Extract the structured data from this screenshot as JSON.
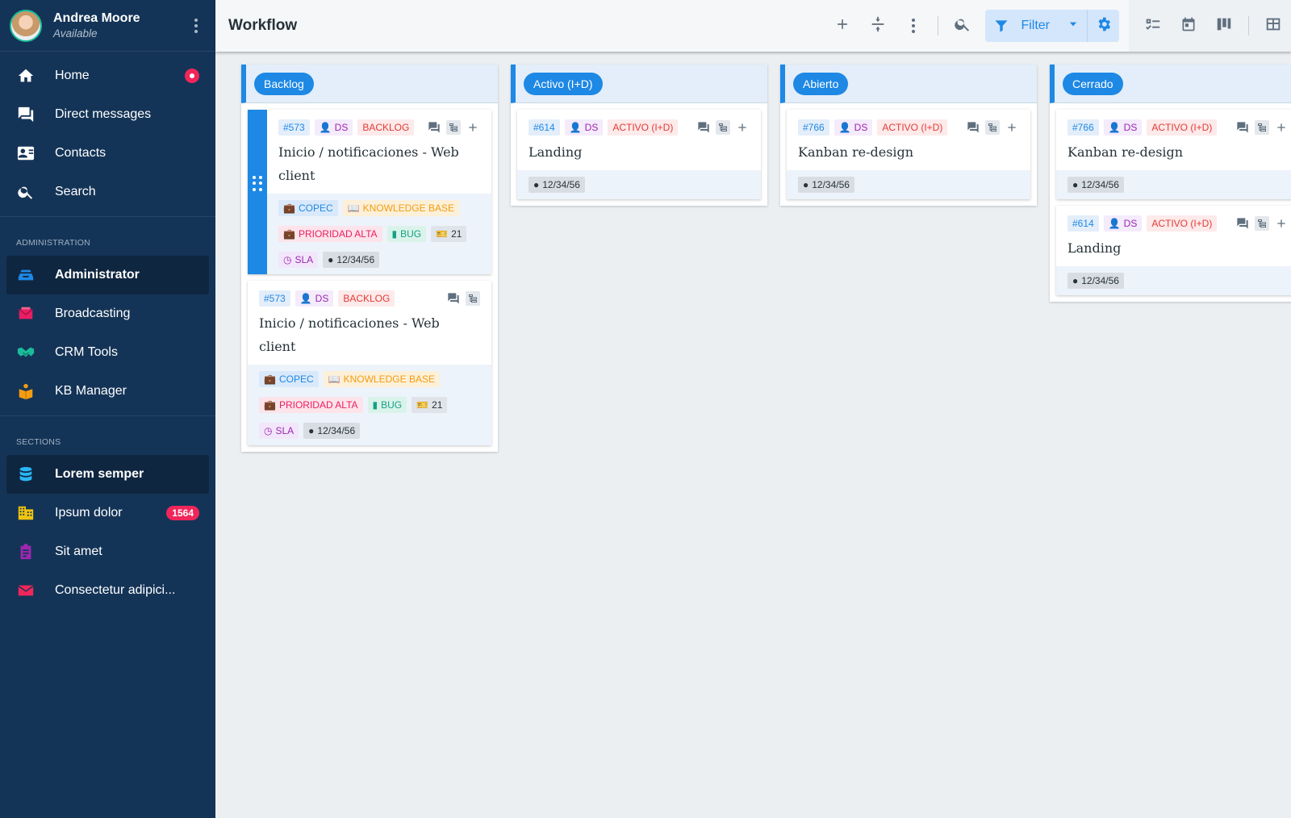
{
  "user": {
    "name": "Andrea Moore",
    "status": "Available"
  },
  "nav": {
    "main": [
      {
        "label": "Home",
        "icon": "home-icon",
        "badge": "dot"
      },
      {
        "label": "Direct messages",
        "icon": "chat-icon"
      },
      {
        "label": "Contacts",
        "icon": "contact-card-icon"
      },
      {
        "label": "Search",
        "icon": "search-icon"
      }
    ],
    "admin_heading": "ADMINISTRATION",
    "admin": [
      {
        "label": "Administrator",
        "icon": "inbox-stack-icon",
        "active": true,
        "color": "#1e88e5"
      },
      {
        "label": "Broadcasting",
        "icon": "envelope-icon",
        "color": "#e91e63"
      },
      {
        "label": "CRM Tools",
        "icon": "handshake-icon",
        "color": "#1abc9c"
      },
      {
        "label": "KB Manager",
        "icon": "book-reader-icon",
        "color": "#f39c12"
      }
    ],
    "sections_heading": "SECTIONS",
    "sections": [
      {
        "label": "Lorem semper",
        "icon": "database-icon",
        "active": true,
        "color": "#29b6f6"
      },
      {
        "label": "Ipsum dolor",
        "icon": "building-icon",
        "badge": "1564",
        "color": "#f1c40f"
      },
      {
        "label": "Sit amet",
        "icon": "clipboard-icon",
        "color": "#9c27b0"
      },
      {
        "label": "Consectetur adipici...",
        "icon": "mail-icon",
        "color": "#f0265a"
      }
    ]
  },
  "toolbar": {
    "title": "Workflow",
    "filter_label": "Filter"
  },
  "colors": {
    "accent": "#1e88e5",
    "sidebar": "#143457",
    "danger": "#f0265a"
  },
  "board": {
    "columns": [
      {
        "name": "Backlog",
        "cards": [
          {
            "id": "#573",
            "user": "DS",
            "status": "BACKLOG",
            "title": "Inicio / notificaciones - Web client",
            "tags": {
              "client": "COPEC",
              "kb": "KNOWLEDGE BASE",
              "priority": "PRIORIDAD ALTA",
              "type": "BUG",
              "count": "21",
              "sla": "SLA",
              "date": "12/34/56"
            }
          },
          {
            "id": "#573",
            "user": "DS",
            "status": "BACKLOG",
            "title": "Inicio / notificaciones - Web client",
            "tags": {
              "client": "COPEC",
              "kb": "KNOWLEDGE BASE",
              "priority": "PRIORIDAD ALTA",
              "type": "BUG",
              "count": "21",
              "sla": "SLA",
              "date": "12/34/56"
            }
          }
        ]
      },
      {
        "name": "Activo (I+D)",
        "cards": [
          {
            "id": "#614",
            "user": "DS",
            "status": "ACTIVO (I+D)",
            "title": "Landing",
            "date": "12/34/56"
          }
        ]
      },
      {
        "name": "Abierto",
        "cards": [
          {
            "id": "#766",
            "user": "DS",
            "status": "ACTIVO (I+D)",
            "title": "Kanban re-design",
            "date": "12/34/56"
          }
        ]
      },
      {
        "name": "Cerrado",
        "cards": [
          {
            "id": "#766",
            "user": "DS",
            "status": "ACTIVO (I+D)",
            "title": "Kanban re-design",
            "date": "12/34/56"
          },
          {
            "id": "#614",
            "user": "DS",
            "status": "ACTIVO (I+D)",
            "title": "Landing",
            "date": "12/34/56"
          }
        ]
      }
    ]
  }
}
